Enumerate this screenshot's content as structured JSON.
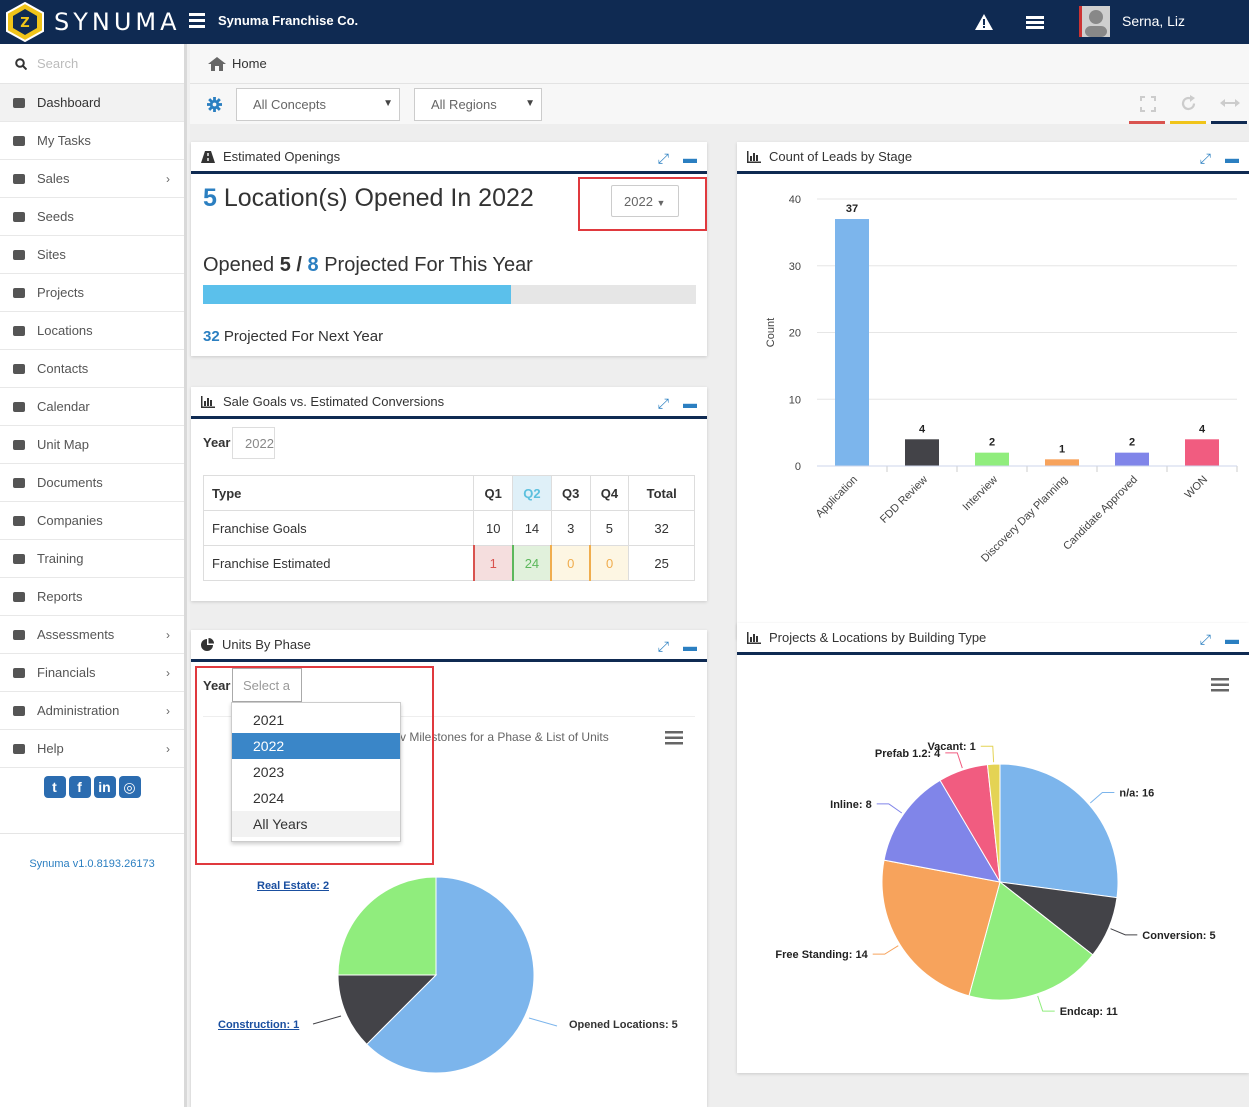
{
  "app": {
    "brand": "SYNUMA",
    "company": "Synuma Franchise Co.",
    "user": "Serna, Liz",
    "version": "Synuma v1.0.8193.26173"
  },
  "icons": {
    "warning": "warning-icon",
    "list": "list-icon",
    "home": "home-icon",
    "gear": "gear-icon",
    "expand": "expand-icon",
    "collapse": "minus-icon"
  },
  "sidebar": {
    "search_placeholder": "Search",
    "items": [
      {
        "label": "Dashboard",
        "icon": "dashboard-icon",
        "chevron": false
      },
      {
        "label": "My Tasks",
        "icon": "tasks-icon",
        "chevron": false
      },
      {
        "label": "Sales",
        "icon": "chart-line-icon",
        "chevron": true
      },
      {
        "label": "Seeds",
        "icon": "grid-icon",
        "chevron": false
      },
      {
        "label": "Sites",
        "icon": "leaf-icon",
        "chevron": false
      },
      {
        "label": "Projects",
        "icon": "road-icon",
        "chevron": false
      },
      {
        "label": "Locations",
        "icon": "building-icon",
        "chevron": false
      },
      {
        "label": "Contacts",
        "icon": "contact-icon",
        "chevron": false
      },
      {
        "label": "Calendar",
        "icon": "calendar-icon",
        "chevron": false
      },
      {
        "label": "Unit Map",
        "icon": "globe-icon",
        "chevron": false
      },
      {
        "label": "Documents",
        "icon": "document-icon",
        "chevron": false
      },
      {
        "label": "Companies",
        "icon": "company-icon",
        "chevron": false
      },
      {
        "label": "Training",
        "icon": "graduation-icon",
        "chevron": false
      },
      {
        "label": "Reports",
        "icon": "pie-icon",
        "chevron": false
      },
      {
        "label": "Assessments",
        "icon": "check-icon",
        "chevron": true
      },
      {
        "label": "Financials",
        "icon": "money-icon",
        "chevron": true
      },
      {
        "label": "Administration",
        "icon": "cogs-icon",
        "chevron": true
      },
      {
        "label": "Help",
        "icon": "question-icon",
        "chevron": true
      }
    ]
  },
  "breadcrumb": "Home",
  "filters": {
    "concepts": "All Concepts",
    "regions": "All Regions"
  },
  "openings": {
    "title": "Estimated Openings",
    "count": "5",
    "headline": " Location(s) Opened In 2022",
    "year": "2022",
    "opened_prefix": "Opened ",
    "opened": "5",
    "slash": " / ",
    "projected": "8",
    "opened_suffix": " Projected For This Year",
    "progress": 0.625,
    "next_count": "32",
    "next_text": " Projected For Next Year"
  },
  "goals": {
    "title": "Sale Goals vs. Estimated Conversions",
    "year_label": "Year",
    "year": "2022",
    "headers": [
      "Type",
      "Q1",
      "Q2",
      "Q3",
      "Q4",
      "Total"
    ],
    "rows": [
      [
        "Franchise Goals",
        "10",
        "14",
        "3",
        "5",
        "32"
      ],
      [
        "Franchise Estimated",
        "1",
        "24",
        "0",
        "0",
        "25"
      ]
    ]
  },
  "units": {
    "title": "Units By Phase",
    "year_label": "Year",
    "placeholder": "Select a",
    "subtitle": "v Milestones for a Phase & List of Units",
    "options": [
      "2021",
      "2022",
      "2023",
      "2024",
      "All Years"
    ],
    "selected": "2022",
    "labels": {
      "real_estate": "Real Estate: 2",
      "construction": "Construction: 1",
      "opened": "Opened Locations: 5"
    }
  },
  "leads": {
    "title": "Count of Leads by Stage"
  },
  "building": {
    "title": "Projects & Locations by Building Type"
  },
  "chart_data": [
    {
      "type": "bar",
      "title": "Count of Leads by Stage",
      "ylabel": "Count",
      "xlabel": "",
      "categories": [
        "Application",
        "FDD Review",
        "Interview",
        "Discovery Day Planning",
        "Candidate Approved",
        "WON"
      ],
      "values": [
        37,
        4,
        2,
        1,
        2,
        4
      ],
      "colors": [
        "#7cb5ec",
        "#434348",
        "#90ed7d",
        "#f7a35c",
        "#8085e9",
        "#f15c80"
      ],
      "ylim": [
        0,
        40
      ],
      "yticks": [
        0,
        10,
        20,
        30,
        40
      ],
      "grid": true
    },
    {
      "type": "pie",
      "title": "Projects & Locations by Building Type",
      "labels": [
        "n/a",
        "Conversion",
        "Endcap",
        "Free Standing",
        "Inline",
        "Prefab 1.2",
        "Vacant"
      ],
      "values": [
        16,
        5,
        11,
        14,
        8,
        4,
        1
      ],
      "colors": [
        "#7cb5ec",
        "#434348",
        "#90ed7d",
        "#f7a35c",
        "#8085e9",
        "#f15c80",
        "#e4d354"
      ]
    },
    {
      "type": "pie",
      "title": "Units By Phase",
      "labels": [
        "Opened Locations",
        "Construction",
        "Real Estate"
      ],
      "values": [
        5,
        1,
        2
      ],
      "colors": [
        "#7cb5ec",
        "#434348",
        "#90ed7d"
      ]
    }
  ]
}
